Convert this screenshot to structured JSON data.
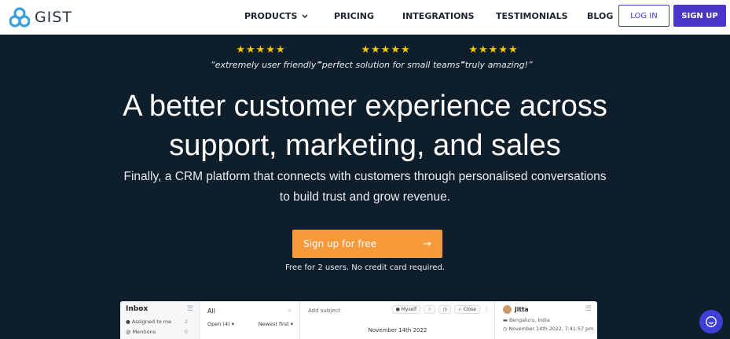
{
  "brand": {
    "name": "GIST"
  },
  "nav": {
    "products": "PRODUCTS",
    "pricing": "PRICING",
    "integrations": "INTEGRATIONS",
    "testimonials": "TESTIMONIALS",
    "blog": "BLOG",
    "login": "LOG IN",
    "signup": "SIGN UP"
  },
  "testimonials": [
    {
      "stars": "★★★★★",
      "quote": "“extremely user friendly”"
    },
    {
      "stars": "★★★★★",
      "quote": "“perfect solution for small teams”"
    },
    {
      "stars": "★★★★★",
      "quote": "“truly amazing!”"
    }
  ],
  "hero": {
    "title_line1": "A better customer experience across",
    "title_line2": "support, marketing, and sales",
    "subtitle_line1": "Finally, a CRM platform that connects with customers through personalised conversations",
    "subtitle_line2": "to build trust and grow revenue.",
    "cta": "Sign up for free",
    "cta_arrow": "→",
    "note": "Free for 2 users. No credit card required."
  },
  "preview": {
    "inbox_title": "Inbox",
    "inbox_items": [
      {
        "label": "Assigned to me",
        "count": "2"
      },
      {
        "label": "Mentions",
        "count": "0"
      }
    ],
    "list_title": "All",
    "list_filter": "Open (4)",
    "list_sort": "Newest first",
    "subject_placeholder": "Add subject",
    "assignee": "Myself",
    "close_label": "Close",
    "date_divider": "November 14th 2022",
    "contact_name": "Jitta",
    "contact_location": "Bengaluru, India",
    "contact_time": "November 14th 2022, 7:41:57 pm"
  },
  "colors": {
    "hero_bg": "#0f1e2b",
    "accent": "#4a36c7",
    "cta": "#f8993a",
    "stars": "#f6c400",
    "logo": "#3aa0dc"
  }
}
